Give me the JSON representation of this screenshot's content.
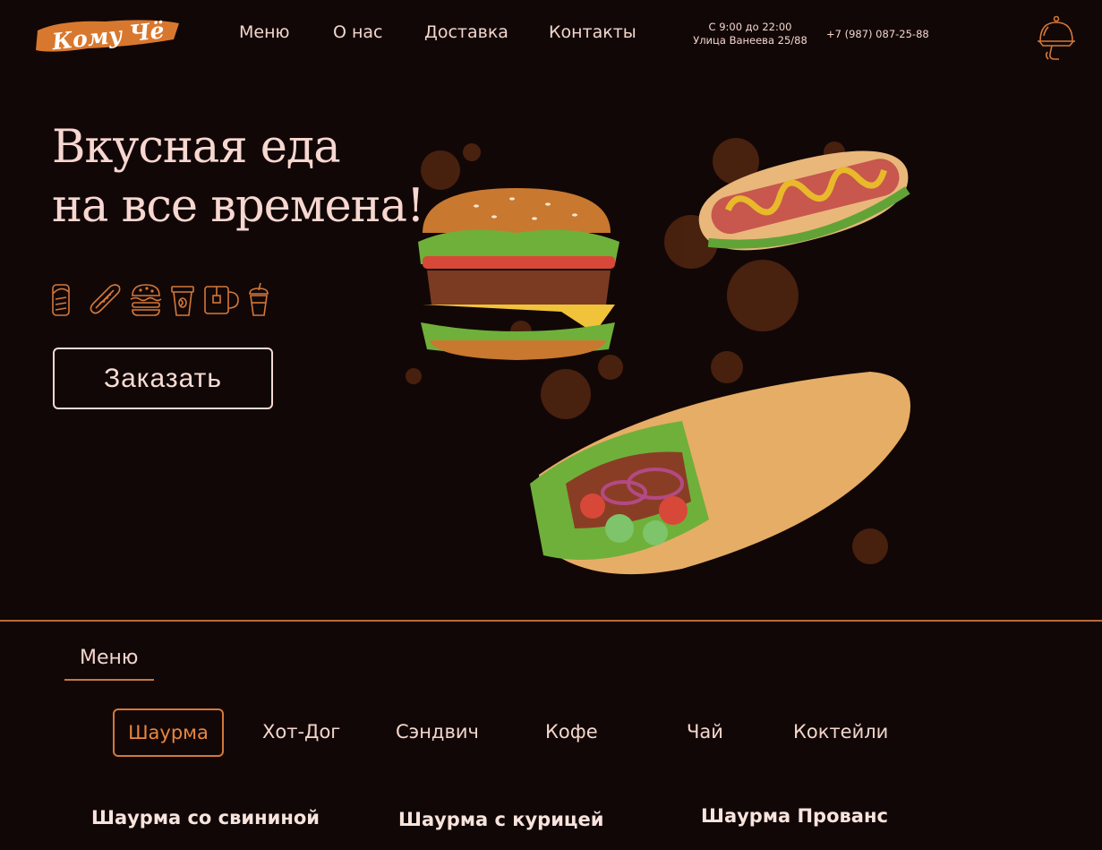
{
  "header": {
    "logo_text": "Кому Чё",
    "nav": [
      "Меню",
      "О нас",
      "Доставка",
      "Контакты"
    ],
    "hours": "С 9:00 до 22:00",
    "address": "Улица Ванеева 25/88",
    "phone": "+7 (987) 087-25-88",
    "cart_icon": "cloche-icon"
  },
  "hero": {
    "title_line1": "Вкусная еда",
    "title_line2": "на все времена!",
    "icons": [
      "shawarma-icon",
      "hotdog-icon",
      "burger-icon",
      "coffee-cup-icon",
      "tea-mug-icon",
      "cocktail-icon"
    ],
    "order_button": "Заказать"
  },
  "menu": {
    "heading": "Меню",
    "categories": [
      "Шаурма",
      "Хот-Дог",
      "Сэндвич",
      "Кофе",
      "Чай",
      "Коктейли"
    ],
    "active_category": "Шаурма",
    "items": [
      "Шаурма со свининой",
      "Шаурма с курицей",
      "Шаурма Прованс"
    ]
  },
  "colors": {
    "background": "#120707",
    "accent": "#d3783a",
    "text": "#f3d6cc"
  }
}
